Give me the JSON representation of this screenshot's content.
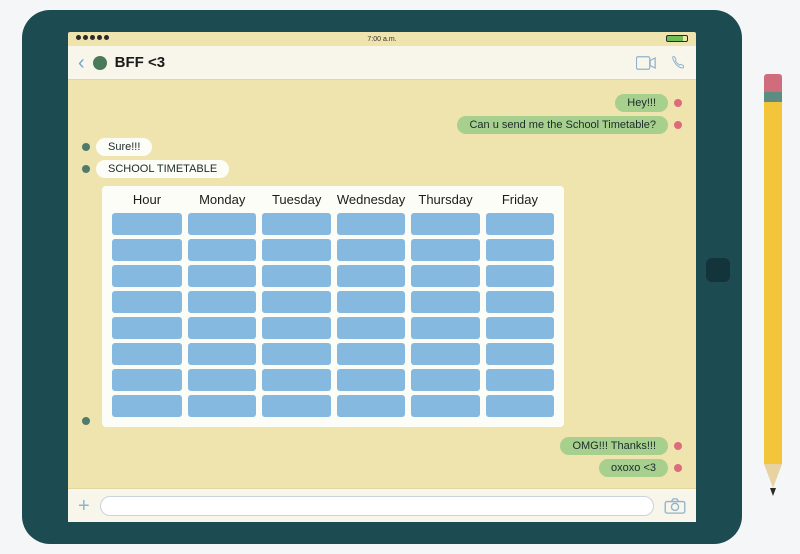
{
  "status": {
    "time": "7:00 a.m."
  },
  "header": {
    "contact_name": "BFF <3"
  },
  "messages": {
    "sent1": "Hey!!!",
    "sent2": "Can u send me the School Timetable?",
    "recv1": "Sure!!!",
    "recv2": "SCHOOL TIMETABLE",
    "sent3": "OMG!!! Thanks!!!",
    "sent4": "oxoxo <3"
  },
  "timetable": {
    "columns": [
      "Hour",
      "Monday",
      "Tuesday",
      "Wednesday",
      "Thursday",
      "Friday"
    ],
    "rows": 8
  },
  "input": {
    "placeholder": ""
  }
}
